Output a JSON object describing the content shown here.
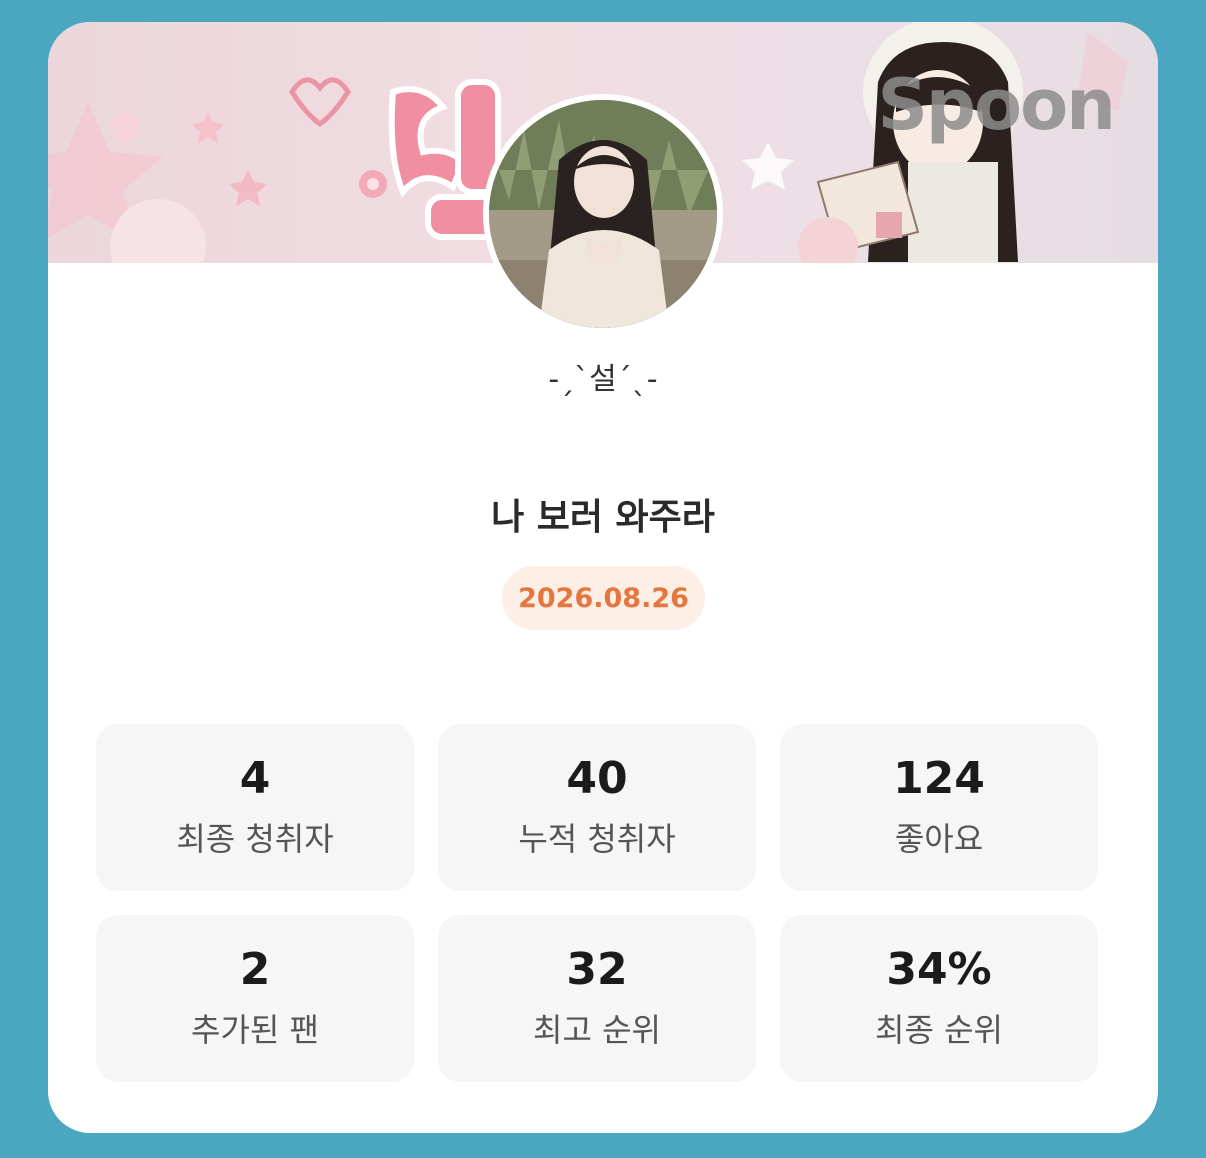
{
  "brand": "Spoon",
  "profile": {
    "nickname": "-ˏˋ설ˊˎ-"
  },
  "broadcast": {
    "title": "나 보러 와주라",
    "date": "2026.08.26"
  },
  "stats": [
    {
      "value": "4",
      "label": "최종 청취자"
    },
    {
      "value": "40",
      "label": "누적 청취자"
    },
    {
      "value": "124",
      "label": "좋아요"
    },
    {
      "value": "2",
      "label": "추가된 팬"
    },
    {
      "value": "32",
      "label": "최고 순위"
    },
    {
      "value": "34%",
      "label": "최종 순위"
    }
  ],
  "colors": {
    "background": "#4ba7c0",
    "card": "#ffffff",
    "date_text": "#e4763e",
    "date_pill": "#fdeee6",
    "stat_tile": "#f6f6f6"
  }
}
